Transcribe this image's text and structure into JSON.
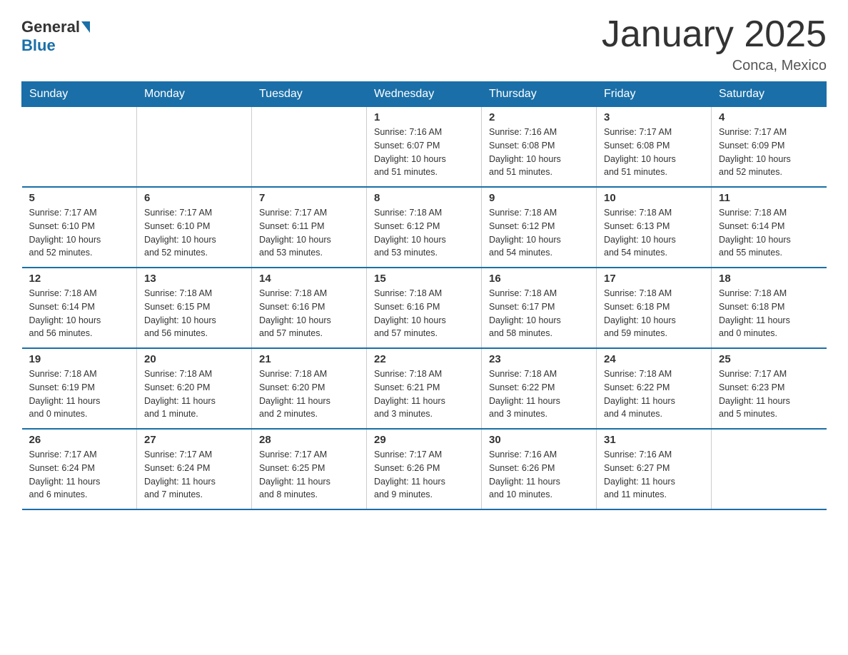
{
  "header": {
    "logo_general": "General",
    "logo_blue": "Blue",
    "month_title": "January 2025",
    "location": "Conca, Mexico"
  },
  "weekdays": [
    "Sunday",
    "Monday",
    "Tuesday",
    "Wednesday",
    "Thursday",
    "Friday",
    "Saturday"
  ],
  "weeks": [
    [
      {
        "day": "",
        "info": ""
      },
      {
        "day": "",
        "info": ""
      },
      {
        "day": "",
        "info": ""
      },
      {
        "day": "1",
        "info": "Sunrise: 7:16 AM\nSunset: 6:07 PM\nDaylight: 10 hours\nand 51 minutes."
      },
      {
        "day": "2",
        "info": "Sunrise: 7:16 AM\nSunset: 6:08 PM\nDaylight: 10 hours\nand 51 minutes."
      },
      {
        "day": "3",
        "info": "Sunrise: 7:17 AM\nSunset: 6:08 PM\nDaylight: 10 hours\nand 51 minutes."
      },
      {
        "day": "4",
        "info": "Sunrise: 7:17 AM\nSunset: 6:09 PM\nDaylight: 10 hours\nand 52 minutes."
      }
    ],
    [
      {
        "day": "5",
        "info": "Sunrise: 7:17 AM\nSunset: 6:10 PM\nDaylight: 10 hours\nand 52 minutes."
      },
      {
        "day": "6",
        "info": "Sunrise: 7:17 AM\nSunset: 6:10 PM\nDaylight: 10 hours\nand 52 minutes."
      },
      {
        "day": "7",
        "info": "Sunrise: 7:17 AM\nSunset: 6:11 PM\nDaylight: 10 hours\nand 53 minutes."
      },
      {
        "day": "8",
        "info": "Sunrise: 7:18 AM\nSunset: 6:12 PM\nDaylight: 10 hours\nand 53 minutes."
      },
      {
        "day": "9",
        "info": "Sunrise: 7:18 AM\nSunset: 6:12 PM\nDaylight: 10 hours\nand 54 minutes."
      },
      {
        "day": "10",
        "info": "Sunrise: 7:18 AM\nSunset: 6:13 PM\nDaylight: 10 hours\nand 54 minutes."
      },
      {
        "day": "11",
        "info": "Sunrise: 7:18 AM\nSunset: 6:14 PM\nDaylight: 10 hours\nand 55 minutes."
      }
    ],
    [
      {
        "day": "12",
        "info": "Sunrise: 7:18 AM\nSunset: 6:14 PM\nDaylight: 10 hours\nand 56 minutes."
      },
      {
        "day": "13",
        "info": "Sunrise: 7:18 AM\nSunset: 6:15 PM\nDaylight: 10 hours\nand 56 minutes."
      },
      {
        "day": "14",
        "info": "Sunrise: 7:18 AM\nSunset: 6:16 PM\nDaylight: 10 hours\nand 57 minutes."
      },
      {
        "day": "15",
        "info": "Sunrise: 7:18 AM\nSunset: 6:16 PM\nDaylight: 10 hours\nand 57 minutes."
      },
      {
        "day": "16",
        "info": "Sunrise: 7:18 AM\nSunset: 6:17 PM\nDaylight: 10 hours\nand 58 minutes."
      },
      {
        "day": "17",
        "info": "Sunrise: 7:18 AM\nSunset: 6:18 PM\nDaylight: 10 hours\nand 59 minutes."
      },
      {
        "day": "18",
        "info": "Sunrise: 7:18 AM\nSunset: 6:18 PM\nDaylight: 11 hours\nand 0 minutes."
      }
    ],
    [
      {
        "day": "19",
        "info": "Sunrise: 7:18 AM\nSunset: 6:19 PM\nDaylight: 11 hours\nand 0 minutes."
      },
      {
        "day": "20",
        "info": "Sunrise: 7:18 AM\nSunset: 6:20 PM\nDaylight: 11 hours\nand 1 minute."
      },
      {
        "day": "21",
        "info": "Sunrise: 7:18 AM\nSunset: 6:20 PM\nDaylight: 11 hours\nand 2 minutes."
      },
      {
        "day": "22",
        "info": "Sunrise: 7:18 AM\nSunset: 6:21 PM\nDaylight: 11 hours\nand 3 minutes."
      },
      {
        "day": "23",
        "info": "Sunrise: 7:18 AM\nSunset: 6:22 PM\nDaylight: 11 hours\nand 3 minutes."
      },
      {
        "day": "24",
        "info": "Sunrise: 7:18 AM\nSunset: 6:22 PM\nDaylight: 11 hours\nand 4 minutes."
      },
      {
        "day": "25",
        "info": "Sunrise: 7:17 AM\nSunset: 6:23 PM\nDaylight: 11 hours\nand 5 minutes."
      }
    ],
    [
      {
        "day": "26",
        "info": "Sunrise: 7:17 AM\nSunset: 6:24 PM\nDaylight: 11 hours\nand 6 minutes."
      },
      {
        "day": "27",
        "info": "Sunrise: 7:17 AM\nSunset: 6:24 PM\nDaylight: 11 hours\nand 7 minutes."
      },
      {
        "day": "28",
        "info": "Sunrise: 7:17 AM\nSunset: 6:25 PM\nDaylight: 11 hours\nand 8 minutes."
      },
      {
        "day": "29",
        "info": "Sunrise: 7:17 AM\nSunset: 6:26 PM\nDaylight: 11 hours\nand 9 minutes."
      },
      {
        "day": "30",
        "info": "Sunrise: 7:16 AM\nSunset: 6:26 PM\nDaylight: 11 hours\nand 10 minutes."
      },
      {
        "day": "31",
        "info": "Sunrise: 7:16 AM\nSunset: 6:27 PM\nDaylight: 11 hours\nand 11 minutes."
      },
      {
        "day": "",
        "info": ""
      }
    ]
  ]
}
